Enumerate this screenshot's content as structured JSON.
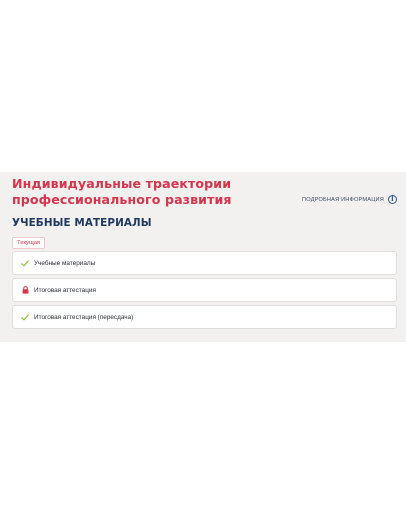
{
  "header": {
    "title": "Индивидуальные траектории профессионального развития",
    "more_info": "ПОДРОБНАЯ ИНФОРМАЦИЯ",
    "info_glyph": "i"
  },
  "section": {
    "title": "УЧЕБНЫЕ МАТЕРИАЛЫ",
    "badge": "Текущая"
  },
  "items": [
    {
      "label": "Учебные материалы",
      "icon": "check-icon",
      "icon_color": "#8fbf3a"
    },
    {
      "label": "Итоговая аттестация",
      "icon": "lock-icon",
      "icon_color": "#d6354b"
    },
    {
      "label": "Итоговая аттестация (пересдача)",
      "icon": "check-icon",
      "icon_color": "#8fbf3a"
    }
  ],
  "colors": {
    "accent": "#d6354b",
    "heading": "#1f3a62",
    "link": "#2d5b9a",
    "panel_bg": "#f2f1f0"
  }
}
